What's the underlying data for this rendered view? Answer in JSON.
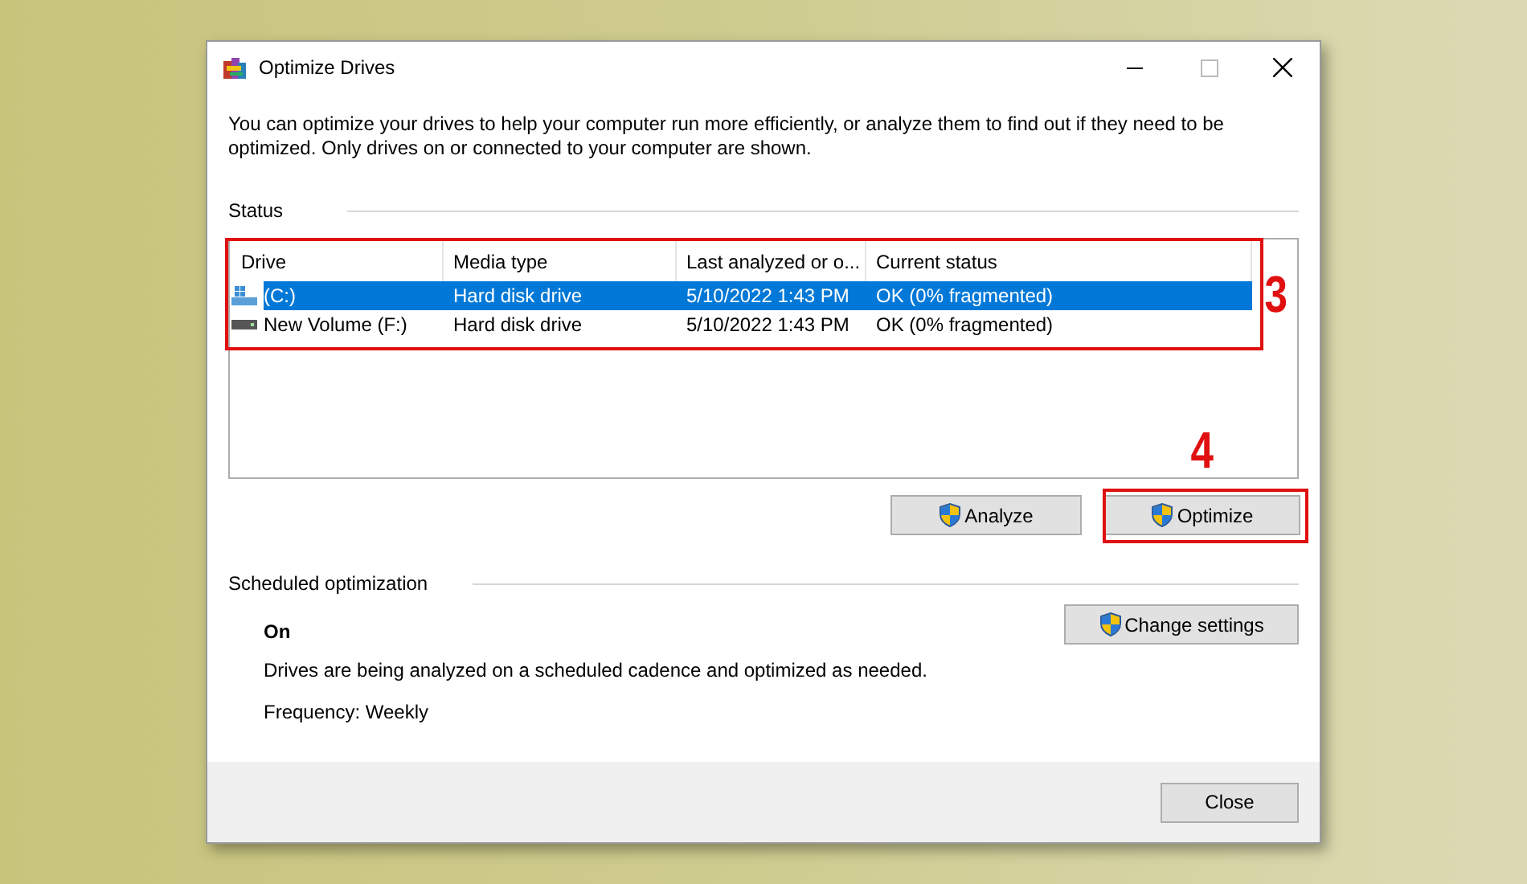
{
  "window": {
    "title": "Optimize Drives"
  },
  "description": "You can optimize your drives to help your computer run more efficiently, or analyze them to find out if they need to be optimized. Only drives on or connected to your computer are shown.",
  "status": {
    "label": "Status",
    "columns": [
      "Drive",
      "Media type",
      "Last analyzed or o...",
      "Current status"
    ],
    "rows": [
      {
        "kind": "system",
        "drive": "(C:)",
        "media_type": "Hard disk drive",
        "last_analyzed": "5/10/2022 1:43 PM",
        "current_status": "OK (0% fragmented)",
        "selected": true
      },
      {
        "kind": "volume",
        "drive": "New Volume (F:)",
        "media_type": "Hard disk drive",
        "last_analyzed": "5/10/2022 1:43 PM",
        "current_status": "OK (0% fragmented)",
        "selected": false
      }
    ],
    "buttons": [
      "Analyze",
      "Optimize"
    ]
  },
  "scheduled": {
    "label": "Scheduled optimization",
    "state": "On",
    "description": "Drives are being analyzed on a scheduled cadence and optimized as needed.",
    "frequency": "Frequency: Weekly",
    "button": "Change settings"
  },
  "footer": {
    "button": "Close"
  },
  "annotations": [
    {
      "kind": "rows",
      "label": "3"
    },
    {
      "kind": "button",
      "label": "4"
    }
  ]
}
